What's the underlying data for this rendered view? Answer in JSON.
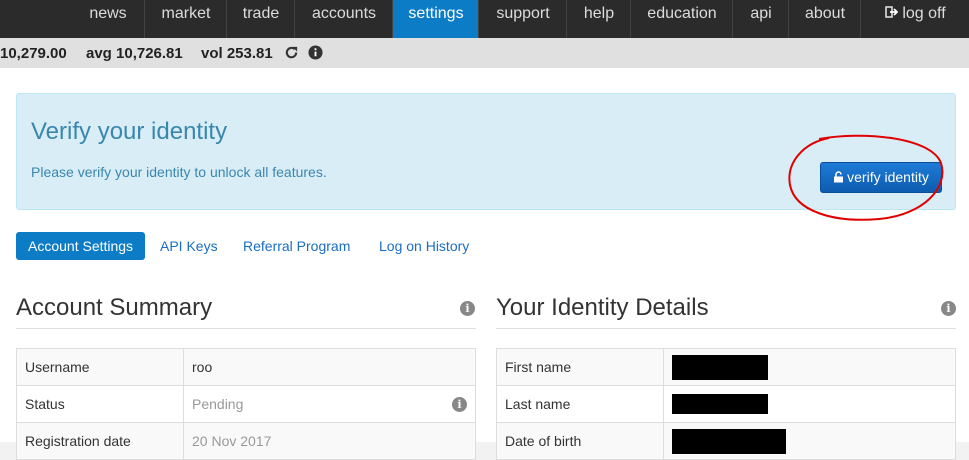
{
  "nav": {
    "items": [
      {
        "label": "news"
      },
      {
        "label": "market"
      },
      {
        "label": "trade"
      },
      {
        "label": "accounts"
      },
      {
        "label": "settings"
      },
      {
        "label": "support"
      },
      {
        "label": "help"
      },
      {
        "label": "education"
      },
      {
        "label": "api"
      },
      {
        "label": "about"
      },
      {
        "label": "log off"
      }
    ],
    "active": "settings"
  },
  "ticker": {
    "last": "10,279.00",
    "avg": "avg 10,726.81",
    "vol": "vol 253.81",
    "icons": [
      "refresh-icon",
      "info-icon"
    ]
  },
  "alert": {
    "title": "Verify your identity",
    "text": "Please verify your identity to unlock all features.",
    "button": "verify identity",
    "button_icon": "unlock-icon"
  },
  "tabs": [
    {
      "label": "Account Settings"
    },
    {
      "label": "API Keys"
    },
    {
      "label": "Referral Program"
    },
    {
      "label": "Log on History"
    }
  ],
  "account_summary": {
    "title": "Account Summary",
    "rows": [
      {
        "label": "Username",
        "value": "roo"
      },
      {
        "label": "Status",
        "value": "Pending"
      },
      {
        "label": "Registration date",
        "value": "20 Nov 2017"
      }
    ]
  },
  "identity_details": {
    "title": "Your Identity Details",
    "rows": [
      {
        "label": "First name"
      },
      {
        "label": "Last name"
      },
      {
        "label": "Date of birth"
      }
    ]
  },
  "colors": {
    "nav_bg": "#2b2b2b",
    "accent": "#0c7cc7",
    "alert_bg": "#d9edf7",
    "alert_text": "#3a87ad",
    "annotation": "#e00000"
  }
}
